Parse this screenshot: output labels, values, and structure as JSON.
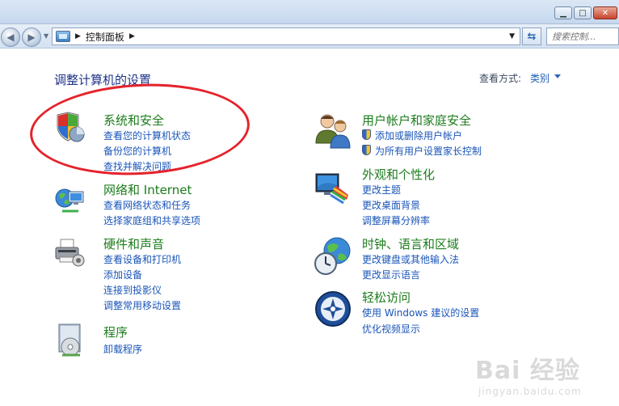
{
  "address": {
    "crumb": "控制面板",
    "search_placeholder": "搜索控制..."
  },
  "header": {
    "title": "调整计算机的设置",
    "view_by_label": "查看方式:",
    "view_by_value": "类别"
  },
  "categories": {
    "security": {
      "title": "系统和安全",
      "links": [
        "查看您的计算机状态",
        "备份您的计算机",
        "查找并解决问题"
      ]
    },
    "network": {
      "title": "网络和 Internet",
      "links": [
        "查看网络状态和任务",
        "选择家庭组和共享选项"
      ]
    },
    "hardware": {
      "title": "硬件和声音",
      "links": [
        "查看设备和打印机",
        "添加设备",
        "连接到投影仪",
        "调整常用移动设置"
      ]
    },
    "programs": {
      "title": "程序",
      "links": [
        "卸载程序"
      ]
    },
    "users": {
      "title": "用户帐户和家庭安全",
      "links": [
        "添加或删除用户帐户",
        "为所有用户设置家长控制"
      ]
    },
    "appearance": {
      "title": "外观和个性化",
      "links": [
        "更改主题",
        "更改桌面背景",
        "调整屏幕分辨率"
      ]
    },
    "clock": {
      "title": "时钟、语言和区域",
      "links": [
        "更改键盘或其他输入法",
        "更改显示语言"
      ]
    },
    "access": {
      "title": "轻松访问",
      "links": [
        "使用 Windows 建议的设置",
        "优化视频显示"
      ]
    }
  },
  "watermark": {
    "main": "Bai 经验",
    "sub": "jingyan.baidu.com"
  },
  "colors": {
    "category_title": "#1c7c1c",
    "link": "#1a55b8",
    "highlight": "#e5222b"
  }
}
